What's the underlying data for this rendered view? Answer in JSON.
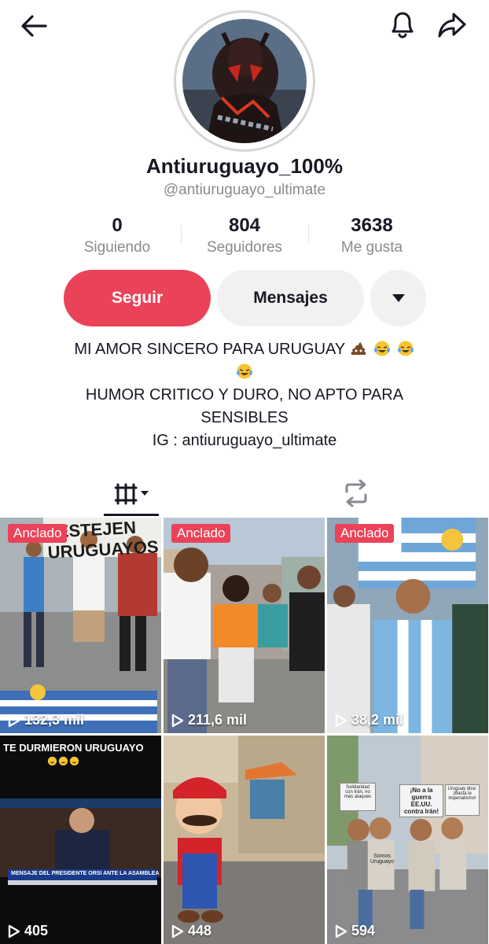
{
  "profile": {
    "display_name": "Antiuruguayo_100%",
    "handle": "@antiuruguayo_ultimate"
  },
  "stats": [
    {
      "value": "0",
      "label": "Siguiendo"
    },
    {
      "value": "804",
      "label": "Seguidores"
    },
    {
      "value": "3638",
      "label": "Me gusta"
    }
  ],
  "actions": {
    "follow_label": "Seguir",
    "message_label": "Mensajes"
  },
  "bio": {
    "line1": "MI AMOR SINCERO PARA URUGUAY",
    "line2": "HUMOR CRITICO Y DURO, NO APTO PARA",
    "line3": "SENSIBLES",
    "line4": "IG : antiuruguayo_ultimate"
  },
  "colors": {
    "accent": "#ea4359",
    "text": "#161823",
    "muted": "#8a8b91",
    "button_bg": "#f1f1f2"
  },
  "tabs": {
    "videos_icon": "grid-lines-icon",
    "repost_icon": "repost-icon"
  },
  "videos": [
    {
      "pinned_label": "Anclado",
      "views": "132,3 mil",
      "caption": "FESTEJEN URUGUAYOS"
    },
    {
      "pinned_label": "Anclado",
      "views": "211,6 mil"
    },
    {
      "pinned_label": "Anclado",
      "views": "38,2 mil"
    },
    {
      "views": "405",
      "caption": "TE DURMIERON URUGUAYO",
      "ticker": "MENSAJE DEL PRESIDENTE ORSI ANTE LA ASAMBLEA GENERAL"
    },
    {
      "views": "448"
    },
    {
      "views": "594",
      "sign1": "Solidaridad con Irán, no más ataques",
      "sign2": "¡No a la guerra EE.UU. contra Irán!",
      "sign3": "Uruguay dice: ¡Basta le imperialismo!",
      "sign4": "Somos Uruguayo"
    }
  ]
}
